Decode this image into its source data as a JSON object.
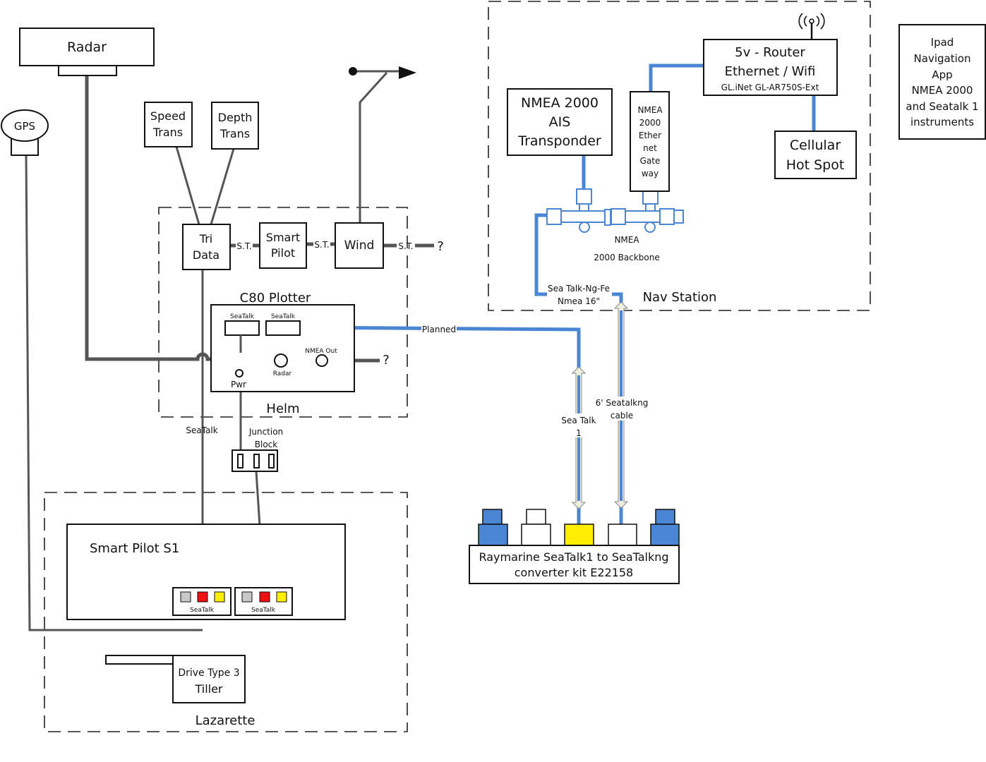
{
  "colors": {
    "wire": "#555555",
    "network": "#4a86d4",
    "seatalk_red": "#ee1111",
    "seatalk_yellow": "#ffee00",
    "grey": "#c8c8c8"
  },
  "radar": {
    "label": "Radar"
  },
  "gps": {
    "label": "GPS"
  },
  "speed": {
    "line1": "Speed",
    "line2": "Trans"
  },
  "depth": {
    "line1": "Depth",
    "line2": "Trans"
  },
  "helm": {
    "label": "Helm",
    "tridata": {
      "line1": "Tri",
      "line2": "Data"
    },
    "smartpilot": {
      "line1": "Smart",
      "line2": "Pilot"
    },
    "wind": "Wind",
    "st": "S.T.",
    "question": "?"
  },
  "plotter": {
    "title": "C80 Plotter",
    "seatalk1": "SeaTalk",
    "seatalk2": "SeaTalk",
    "pwr": "Pwr",
    "radar": "Radar",
    "nmea_out": "NMEA Out",
    "question": "?"
  },
  "planned": "Planned",
  "seatalk_label": "SeaTalk",
  "junction": {
    "line1": "Junction",
    "line2": "Block"
  },
  "lazarette": {
    "label": "Lazarette",
    "smartpilot_s1": "Smart Pilot S1",
    "conn1": "SeaTalk",
    "conn2": "SeaTalk",
    "drive": {
      "line1": "Drive Type 3",
      "line2": "Tiller"
    }
  },
  "nav": {
    "label": "Nav Station",
    "ais": {
      "line1": "NMEA 2000",
      "line2": "AIS",
      "line3": "Transponder"
    },
    "gateway": [
      "NMEA",
      "2000",
      "Ether",
      "net",
      "Gate",
      "way"
    ],
    "router": {
      "line1": "5v - Router",
      "line2": "Ethernet / Wifi",
      "line3": "GL.iNet GL-AR750S-Ext"
    },
    "cellular": {
      "line1": "Cellular",
      "line2": "Hot Spot"
    },
    "backbone": {
      "line1": "NMEA",
      "line2": "2000 Backbone"
    },
    "ng_fe": {
      "line1": "Sea Talk-Ng-Fe",
      "line2": "Nmea 16\""
    }
  },
  "ipad": [
    "Ipad",
    "Navigation",
    "App",
    "NMEA 2000",
    "and Seatalk 1",
    "instruments"
  ],
  "seatalk1_cable": {
    "line1": "Sea Talk",
    "line2": "1"
  },
  "seatalkng_cable": {
    "line1": "6' Seatalkng",
    "line2": "cable"
  },
  "converter": {
    "line1": "Raymarine SeaTalk1 to SeaTalkng",
    "line2": "converter kit E22158"
  }
}
